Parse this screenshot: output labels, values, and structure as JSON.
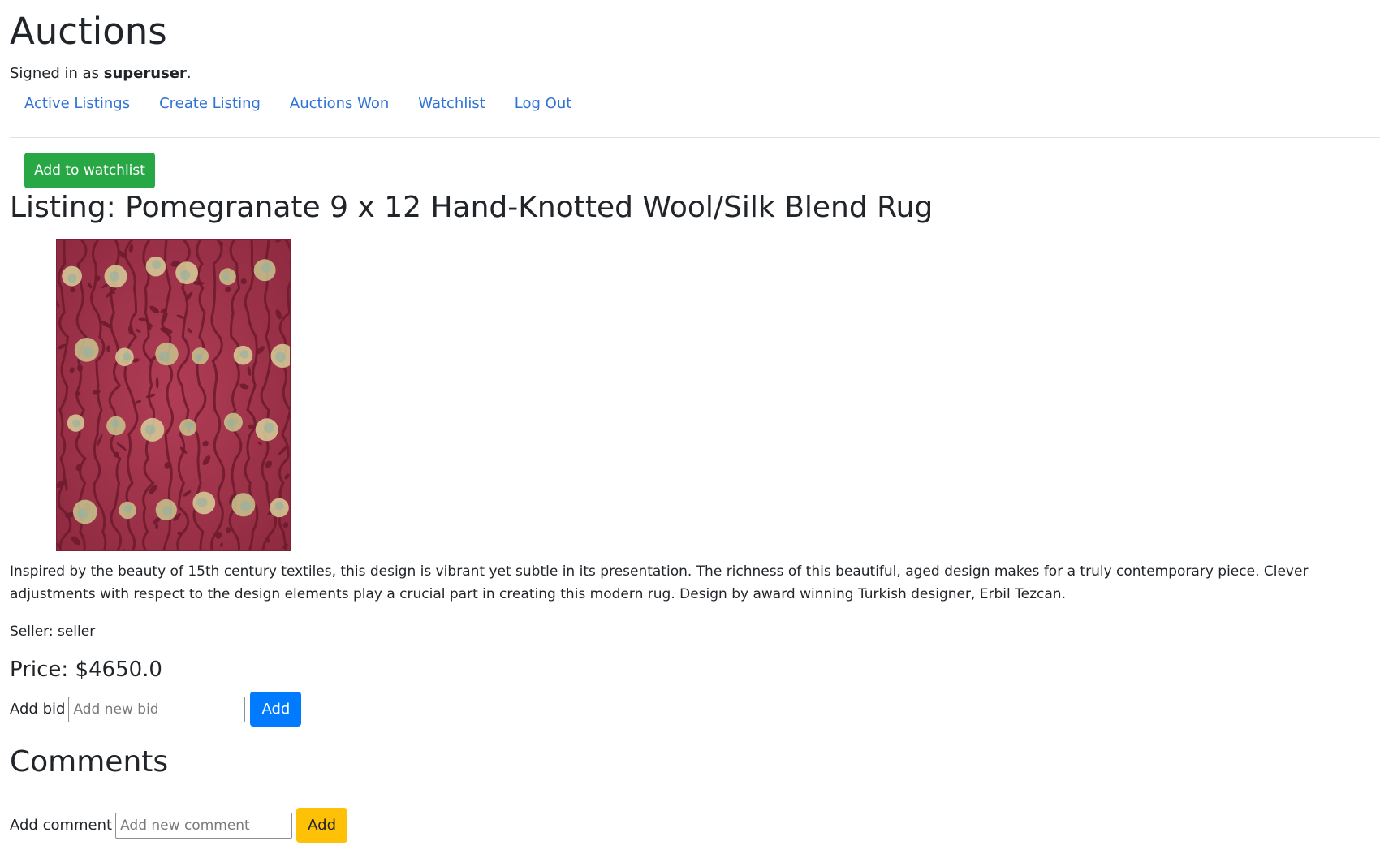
{
  "header": {
    "title": "Auctions",
    "signed_in_prefix": "Signed in as ",
    "username": "superuser",
    "signed_in_suffix": "."
  },
  "nav": {
    "items": [
      {
        "label": "Active Listings"
      },
      {
        "label": "Create Listing"
      },
      {
        "label": "Auctions Won"
      },
      {
        "label": "Watchlist"
      },
      {
        "label": "Log Out"
      }
    ]
  },
  "watchlist_button": {
    "label": "Add to watchlist",
    "color": "#28a745"
  },
  "listing": {
    "title": "Listing: Pomegranate 9 x 12 Hand-Knotted Wool/Silk Blend Rug",
    "image_alt": "Pomegranate rug",
    "description": "Inspired by the beauty of 15th century textiles, this design is vibrant yet subtle in its presentation. The richness of this beautiful, aged design makes for a truly contemporary piece. Clever adjustments with respect to the design elements play a crucial part in creating this modern rug. Design by award winning Turkish designer, Erbil Tezcan.",
    "seller": "Seller: seller",
    "price": "Price: $4650.0"
  },
  "bid_form": {
    "label": "Add bid",
    "placeholder": "Add new bid",
    "value": "",
    "button_label": "Add",
    "button_color": "#007bff"
  },
  "comments": {
    "heading": "Comments",
    "label": "Add comment",
    "placeholder": "Add new comment",
    "value": "",
    "button_label": "Add",
    "button_color": "#ffc107"
  },
  "colors": {
    "link": "#2f73d6",
    "text": "#212529",
    "rug_base": "#a3344a"
  }
}
